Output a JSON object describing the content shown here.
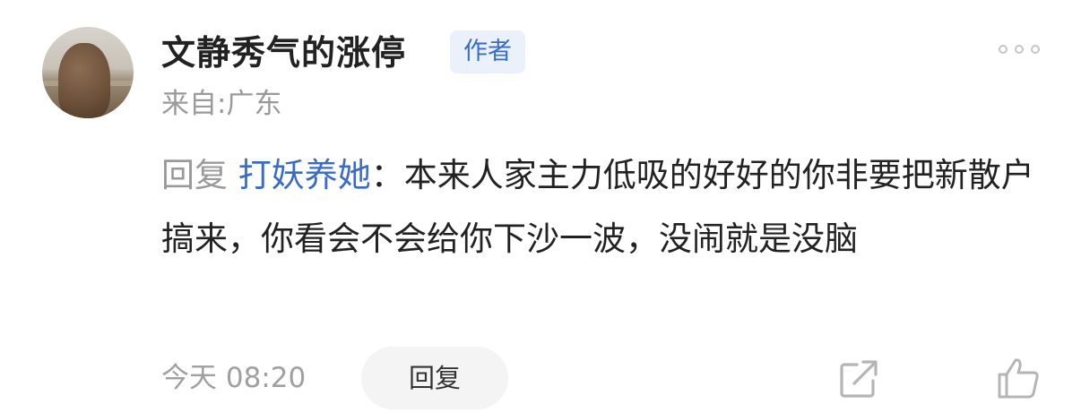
{
  "comment": {
    "author": {
      "name": "文静秀气的涨停",
      "badge": "作者",
      "location": "来自:广东",
      "avatar": "avatar-bear-photo"
    },
    "reply_prefix": "回复",
    "reply_to": "打妖养她",
    "separator": "：",
    "text": "本来人家主力低吸的好好的你非要把新散户搞来，你看会不会给你下沙一波，没闹就是没脑",
    "time": "今天 08:20",
    "actions": {
      "reply_label": "回复",
      "share_icon": "share-icon",
      "like_icon": "thumbs-up-icon",
      "more_icon": "more-icon"
    }
  },
  "colors": {
    "accent": "#3a6cc7",
    "badge_bg": "#eaf1fb",
    "muted": "#9a9a9a",
    "text": "#222222",
    "button_bg": "#f4f4f4"
  }
}
